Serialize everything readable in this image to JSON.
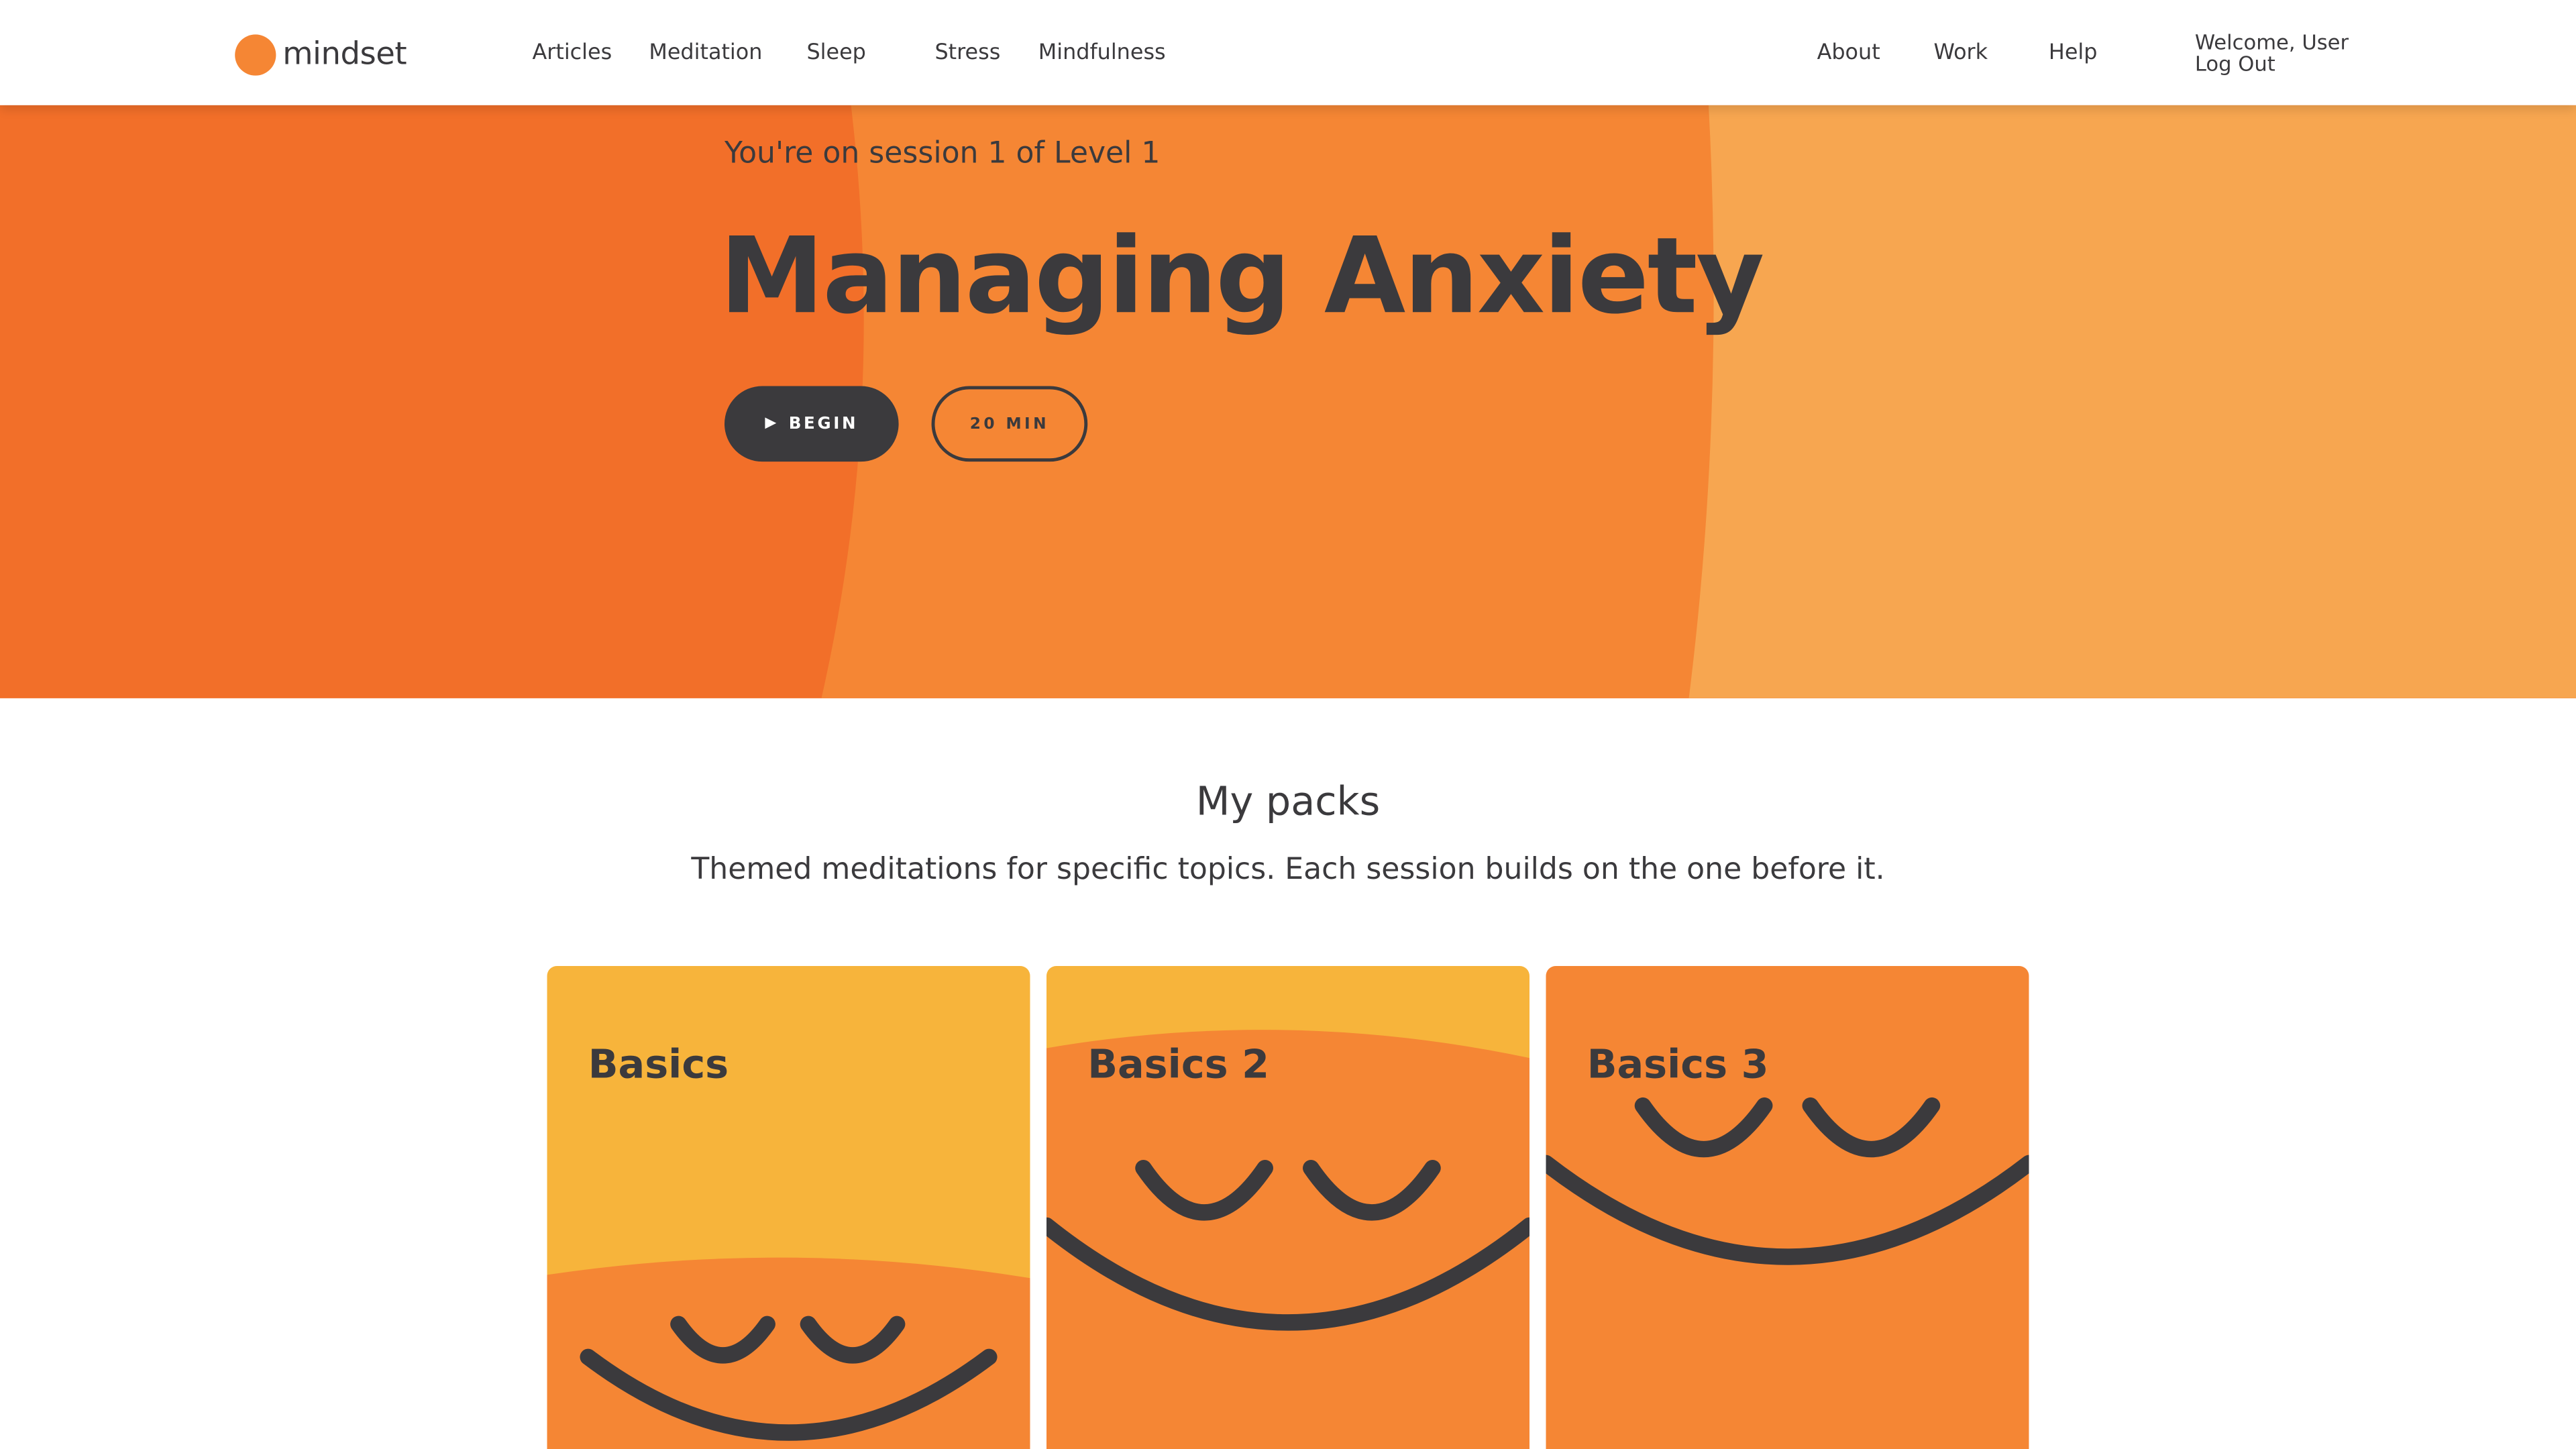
{
  "brand": {
    "name": "mindset",
    "accent": "#f58634"
  },
  "nav": {
    "left": [
      "Articles",
      "Meditation",
      "Sleep",
      "Stress",
      "Mindfulness"
    ],
    "right": [
      "About",
      "Work",
      "Help"
    ]
  },
  "user": {
    "welcome": "Welcome, User",
    "logout": "Log Out"
  },
  "hero": {
    "eyebrow": "You're on session 1 of Level 1",
    "title": "Managing Anxiety",
    "begin_label": "BEGIN",
    "duration_label": "20 MIN",
    "colors": {
      "dark": "#f26f29",
      "mid": "#f58634",
      "light": "#f7a650",
      "text": "#3b3a3d"
    }
  },
  "packs": {
    "title": "My packs",
    "subtitle": "Themed meditations for specific topics. Each session builds on the one before it.",
    "items": [
      {
        "label": "Basics",
        "icon": "smiling-face-icon"
      },
      {
        "label": "Basics 2",
        "icon": "smiling-face-icon"
      },
      {
        "label": "Basics 3",
        "icon": "smiling-face-icon"
      }
    ],
    "colors": {
      "yellow": "#f7b43b",
      "orange": "#f58634"
    }
  }
}
